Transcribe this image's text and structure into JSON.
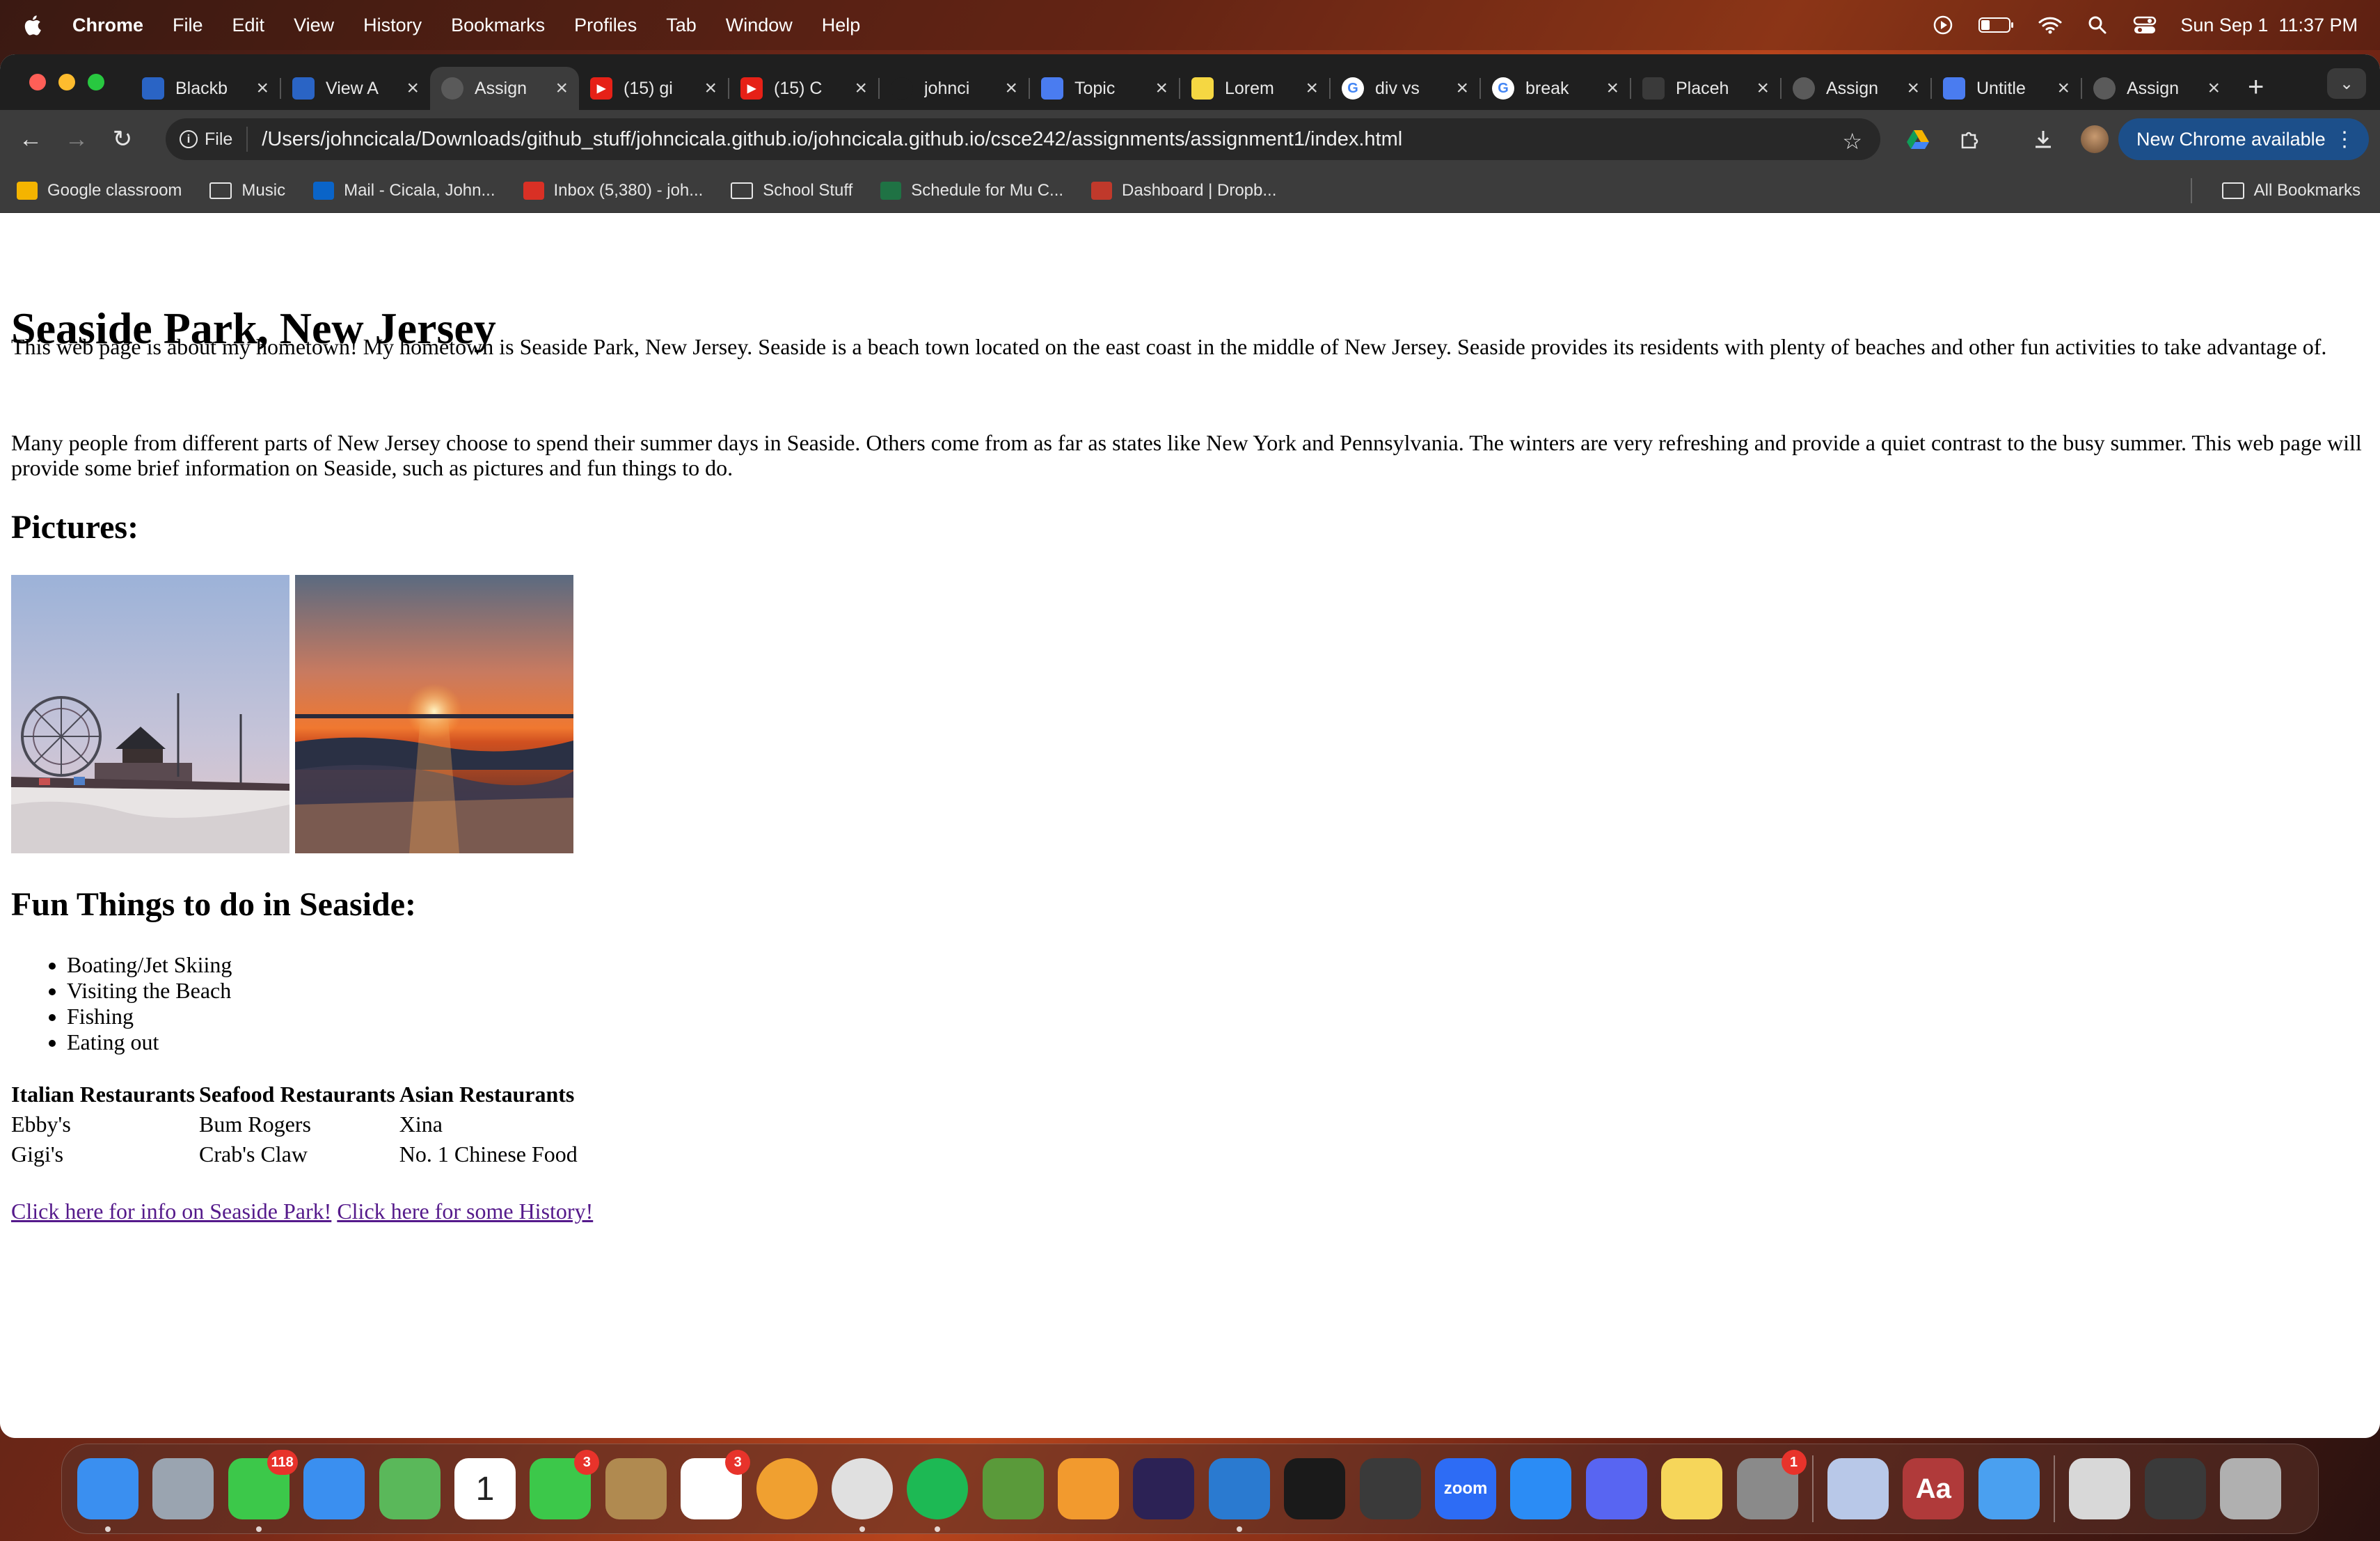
{
  "menubar": {
    "app_name": "Chrome",
    "menus": [
      "File",
      "Edit",
      "View",
      "History",
      "Bookmarks",
      "Profiles",
      "Tab",
      "Window",
      "Help"
    ],
    "clock": "Sun Sep 1  11:37 PM"
  },
  "tabs": [
    {
      "title": "Blackb",
      "icon": "blackboard-icon",
      "color": "#2a64c5",
      "active": false
    },
    {
      "title": "View A",
      "icon": "blackboard-icon",
      "color": "#2a64c5",
      "active": false
    },
    {
      "title": "Assign",
      "icon": "globe-icon",
      "color": "#5a5a5a",
      "active": true
    },
    {
      "title": "(15) gi",
      "icon": "youtube-icon",
      "color": "#e62117",
      "active": false
    },
    {
      "title": "(15) C",
      "icon": "youtube-icon",
      "color": "#e62117",
      "active": false
    },
    {
      "title": "johnci",
      "icon": "github-icon",
      "color": "#1f1f1f",
      "active": false
    },
    {
      "title": "Topic",
      "icon": "docs-icon",
      "color": "#4a7cf0",
      "active": false
    },
    {
      "title": "Lorem",
      "icon": "lorem-icon",
      "color": "#f5d742",
      "active": false
    },
    {
      "title": "div vs",
      "icon": "google-icon",
      "color": "#ffffff",
      "active": false
    },
    {
      "title": "break",
      "icon": "google-icon",
      "color": "#ffffff",
      "active": false
    },
    {
      "title": "Placeh",
      "icon": "placeholder-icon",
      "color": "#3a3a3a",
      "active": false
    },
    {
      "title": "Assign",
      "icon": "globe-icon",
      "color": "#5a5a5a",
      "active": false
    },
    {
      "title": "Untitle",
      "icon": "docs-icon",
      "color": "#4a7cf0",
      "active": false
    },
    {
      "title": "Assign",
      "icon": "globe-icon",
      "color": "#5a5a5a",
      "active": false
    }
  ],
  "toolbar": {
    "file_chip": "File",
    "url": "/Users/johncicala/Downloads/github_stuff/johncicala.github.io/johncicala.github.io/csce242/assignments/assignment1/index.html",
    "update_label": "New Chrome available"
  },
  "bookmarks": {
    "items": [
      {
        "label": "Google classroom",
        "icon": "classroom-icon",
        "color": "#f4b400"
      },
      {
        "label": "Music",
        "icon": "folder-icon",
        "color": ""
      },
      {
        "label": "Mail - Cicala, John...",
        "icon": "outlook-icon",
        "color": "#0a64c8"
      },
      {
        "label": "Inbox (5,380) - joh...",
        "icon": "gmail-icon",
        "color": "#d93025"
      },
      {
        "label": "School Stuff",
        "icon": "folder-icon",
        "color": ""
      },
      {
        "label": "Schedule for Mu C...",
        "icon": "excel-icon",
        "color": "#1f7244"
      },
      {
        "label": "Dashboard | Dropb...",
        "icon": "dropbox-icon",
        "color": "#c0392b"
      }
    ],
    "all_label": "All Bookmarks"
  },
  "page": {
    "title": "Seaside Park, New Jersey",
    "intro": "This web page is about my hometown! My hometown is Seaside Park, New Jersey. Seaside is a beach town located on the east coast in the middle of New Jersey. Seaside provides its residents with plenty of beaches and other fun activities to take advantage of.",
    "para2": "Many people from different parts of New Jersey choose to spend their summer days in Seaside. Others come from as far as states like New York and Pennsylvania. The winters are very refreshing and provide a quiet contrast to the busy summer. This web page will provide some brief information on Seaside, such as pictures and fun things to do.",
    "pictures_heading": "Pictures:",
    "fun_heading": "Fun Things to do in Seaside:",
    "fun_items": [
      "Boating/Jet Skiing",
      "Visiting the Beach",
      "Fishing",
      "Eating out"
    ],
    "table": {
      "headers": [
        "Italian Restaurants",
        "Seafood Restaurants",
        "Asian Restaurants"
      ],
      "rows": [
        [
          "Ebby's",
          "Bum Rogers",
          "Xina"
        ],
        [
          "Gigi's",
          "Crab's Claw",
          "No. 1 Chinese Food"
        ]
      ]
    },
    "links": [
      "Click here for info on Seaside Park!",
      "Click here for some History!"
    ]
  },
  "dock": {
    "apps": [
      {
        "name": "finder-icon",
        "color": "#3a8ff0",
        "badge": "",
        "running": true
      },
      {
        "name": "launchpad-icon",
        "color": "#9aa4b0",
        "badge": "",
        "running": false
      },
      {
        "name": "messages-icon",
        "color": "#3cc84a",
        "badge": "118",
        "running": true
      },
      {
        "name": "mail-icon",
        "color": "#3a8ff0",
        "badge": "",
        "running": false
      },
      {
        "name": "maps-icon",
        "color": "#5ab85a",
        "badge": "",
        "running": false
      },
      {
        "name": "calendar-icon",
        "color": "#ffffff",
        "badge": "",
        "running": false,
        "text": "1"
      },
      {
        "name": "facetime-icon",
        "color": "#3cc84a",
        "badge": "3",
        "running": false
      },
      {
        "name": "contacts-icon",
        "color": "#b08a50",
        "badge": "",
        "running": false
      },
      {
        "name": "reminders-icon",
        "color": "#ffffff",
        "badge": "3",
        "running": false
      },
      {
        "name": "photos-icon",
        "color": "#f0a030",
        "badge": "",
        "running": false
      },
      {
        "name": "chrome-icon",
        "color": "#e0e0e0",
        "badge": "",
        "running": true
      },
      {
        "name": "spotify-icon",
        "color": "#1db954",
        "badge": "",
        "running": true
      },
      {
        "name": "game-icon",
        "color": "#5a9a3a",
        "badge": "",
        "running": false
      },
      {
        "name": "pages-icon",
        "color": "#f29a2e",
        "badge": "",
        "running": false
      },
      {
        "name": "eclipse-icon",
        "color": "#2c2255",
        "badge": "",
        "running": false
      },
      {
        "name": "vscode-icon",
        "color": "#2a7ad0",
        "badge": "",
        "running": true
      },
      {
        "name": "terminal-icon",
        "color": "#1a1a1a",
        "badge": "",
        "running": false
      },
      {
        "name": "chess-icon",
        "color": "#3a3a3a",
        "badge": "",
        "running": false
      },
      {
        "name": "zoom-icon",
        "color": "#2d6cf5",
        "badge": "",
        "running": false,
        "text": "zoom"
      },
      {
        "name": "app-store-icon",
        "color": "#2b8cf5",
        "badge": "",
        "running": false
      },
      {
        "name": "discord-icon",
        "color": "#5865f2",
        "badge": "",
        "running": false
      },
      {
        "name": "notes-icon",
        "color": "#f6d65a",
        "badge": "",
        "running": false
      },
      {
        "name": "system-settings-icon",
        "color": "#8a8a8a",
        "badge": "1",
        "running": false
      },
      {
        "name": "preview-icon",
        "color": "#b8c8e8",
        "badge": "",
        "running": false
      },
      {
        "name": "dictionary-icon",
        "color": "#b03a3a",
        "badge": "",
        "running": false,
        "text": "Aa"
      },
      {
        "name": "weather-icon",
        "color": "#4aa0f0",
        "badge": "",
        "running": false
      },
      {
        "name": "documents-stack-icon",
        "color": "#d8d8d8",
        "badge": "",
        "running": false
      },
      {
        "name": "downloads-stack-icon",
        "color": "#3a3a3a",
        "badge": "",
        "running": false
      },
      {
        "name": "trash-icon",
        "color": "#b0b0b0",
        "badge": "",
        "running": false
      }
    ]
  }
}
